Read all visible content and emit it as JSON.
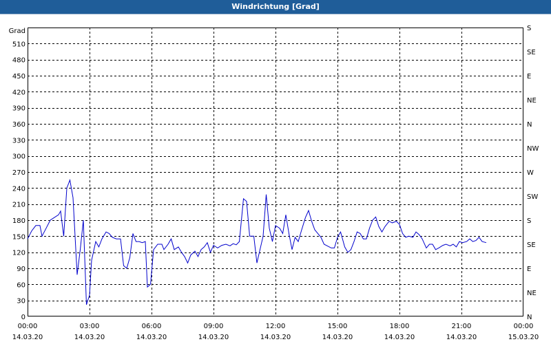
{
  "window": {
    "title": "Windrichtung [Grad]"
  },
  "colors": {
    "titlebar": "#1f5d99",
    "series": "#0000cc",
    "grid": "#000000",
    "background": "#ffffff"
  },
  "chart_data": {
    "type": "line",
    "title": "Windrichtung [Grad]",
    "ylabel": "Grad",
    "ylim": [
      0,
      540
    ],
    "y_ticks": [
      0,
      30,
      60,
      90,
      120,
      150,
      180,
      210,
      240,
      270,
      300,
      330,
      360,
      390,
      420,
      450,
      480,
      510
    ],
    "y2_ticks": [
      "N",
      "NE",
      "E",
      "SE",
      "S",
      "SW",
      "W",
      "NW",
      "N",
      "NE",
      "E",
      "SE",
      "S"
    ],
    "x_ticks": [
      {
        "time": "00:00",
        "date": "14.03.20"
      },
      {
        "time": "03:00",
        "date": "14.03.20"
      },
      {
        "time": "06:00",
        "date": "14.03.20"
      },
      {
        "time": "09:00",
        "date": "14.03.20"
      },
      {
        "time": "12:00",
        "date": "14.03.20"
      },
      {
        "time": "15:00",
        "date": "14.03.20"
      },
      {
        "time": "18:00",
        "date": "14.03.20"
      },
      {
        "time": "21:00",
        "date": "14.03.20"
      },
      {
        "time": "00:00",
        "date": "15.03.20"
      }
    ],
    "x_unit": "hours since 14.03.20 00:00",
    "xlim": [
      0,
      24
    ],
    "grid": true,
    "series": [
      {
        "points": [
          [
            0.0,
            145
          ],
          [
            0.2,
            160
          ],
          [
            0.4,
            170
          ],
          [
            0.6,
            170
          ],
          [
            0.7,
            150
          ],
          [
            0.9,
            165
          ],
          [
            1.1,
            180
          ],
          [
            1.3,
            185
          ],
          [
            1.5,
            190
          ],
          [
            1.6,
            197
          ],
          [
            1.75,
            150
          ],
          [
            1.9,
            240
          ],
          [
            2.05,
            255
          ],
          [
            2.2,
            222
          ],
          [
            2.4,
            78
          ],
          [
            2.55,
            125
          ],
          [
            2.7,
            180
          ],
          [
            2.85,
            22
          ],
          [
            3.0,
            40
          ],
          [
            3.1,
            105
          ],
          [
            3.3,
            140
          ],
          [
            3.45,
            130
          ],
          [
            3.6,
            145
          ],
          [
            3.8,
            158
          ],
          [
            3.95,
            155
          ],
          [
            4.1,
            148
          ],
          [
            4.3,
            145
          ],
          [
            4.5,
            145
          ],
          [
            4.65,
            95
          ],
          [
            4.8,
            90
          ],
          [
            4.95,
            110
          ],
          [
            5.1,
            155
          ],
          [
            5.25,
            140
          ],
          [
            5.4,
            140
          ],
          [
            5.55,
            138
          ],
          [
            5.7,
            140
          ],
          [
            5.8,
            55
          ],
          [
            5.95,
            60
          ],
          [
            6.1,
            125
          ],
          [
            6.3,
            135
          ],
          [
            6.5,
            135
          ],
          [
            6.6,
            125
          ],
          [
            6.8,
            135
          ],
          [
            6.95,
            145
          ],
          [
            7.1,
            125
          ],
          [
            7.3,
            130
          ],
          [
            7.45,
            120
          ],
          [
            7.6,
            112
          ],
          [
            7.75,
            100
          ],
          [
            7.9,
            115
          ],
          [
            8.1,
            122
          ],
          [
            8.25,
            112
          ],
          [
            8.4,
            125
          ],
          [
            8.55,
            130
          ],
          [
            8.7,
            138
          ],
          [
            8.85,
            120
          ],
          [
            9.0,
            133
          ],
          [
            9.2,
            128
          ],
          [
            9.4,
            133
          ],
          [
            9.6,
            135
          ],
          [
            9.8,
            132
          ],
          [
            9.95,
            136
          ],
          [
            10.1,
            134
          ],
          [
            10.25,
            140
          ],
          [
            10.45,
            220
          ],
          [
            10.6,
            215
          ],
          [
            10.75,
            150
          ],
          [
            10.95,
            150
          ],
          [
            11.1,
            100
          ],
          [
            11.25,
            125
          ],
          [
            11.4,
            150
          ],
          [
            11.55,
            228
          ],
          [
            11.7,
            165
          ],
          [
            11.85,
            140
          ],
          [
            12.0,
            170
          ],
          [
            12.2,
            165
          ],
          [
            12.35,
            155
          ],
          [
            12.5,
            190
          ],
          [
            12.65,
            155
          ],
          [
            12.8,
            125
          ],
          [
            12.95,
            148
          ],
          [
            13.1,
            140
          ],
          [
            13.25,
            160
          ],
          [
            13.45,
            185
          ],
          [
            13.6,
            198
          ],
          [
            13.75,
            178
          ],
          [
            13.9,
            162
          ],
          [
            14.05,
            155
          ],
          [
            14.2,
            148
          ],
          [
            14.35,
            135
          ],
          [
            14.5,
            132
          ],
          [
            14.7,
            128
          ],
          [
            14.85,
            128
          ],
          [
            15.0,
            148
          ],
          [
            15.15,
            158
          ],
          [
            15.35,
            130
          ],
          [
            15.5,
            120
          ],
          [
            15.65,
            125
          ],
          [
            15.8,
            140
          ],
          [
            15.95,
            158
          ],
          [
            16.1,
            155
          ],
          [
            16.25,
            145
          ],
          [
            16.4,
            145
          ],
          [
            16.55,
            165
          ],
          [
            16.7,
            180
          ],
          [
            16.85,
            186
          ],
          [
            17.0,
            168
          ],
          [
            17.15,
            158
          ],
          [
            17.3,
            168
          ],
          [
            17.5,
            178
          ],
          [
            17.65,
            175
          ],
          [
            17.85,
            178
          ],
          [
            18.0,
            172
          ],
          [
            18.15,
            155
          ],
          [
            18.3,
            148
          ],
          [
            18.45,
            150
          ],
          [
            18.65,
            148
          ],
          [
            18.8,
            158
          ],
          [
            18.95,
            153
          ],
          [
            19.1,
            145
          ],
          [
            19.3,
            128
          ],
          [
            19.45,
            135
          ],
          [
            19.6,
            135
          ],
          [
            19.75,
            125
          ],
          [
            19.9,
            128
          ],
          [
            20.1,
            133
          ],
          [
            20.25,
            135
          ],
          [
            20.45,
            132
          ],
          [
            20.6,
            135
          ],
          [
            20.75,
            130
          ],
          [
            20.9,
            140
          ],
          [
            21.05,
            138
          ],
          [
            21.25,
            140
          ],
          [
            21.4,
            145
          ],
          [
            21.55,
            140
          ],
          [
            21.7,
            142
          ],
          [
            21.85,
            148
          ],
          [
            22.0,
            140
          ],
          [
            22.2,
            138
          ]
        ]
      }
    ]
  }
}
